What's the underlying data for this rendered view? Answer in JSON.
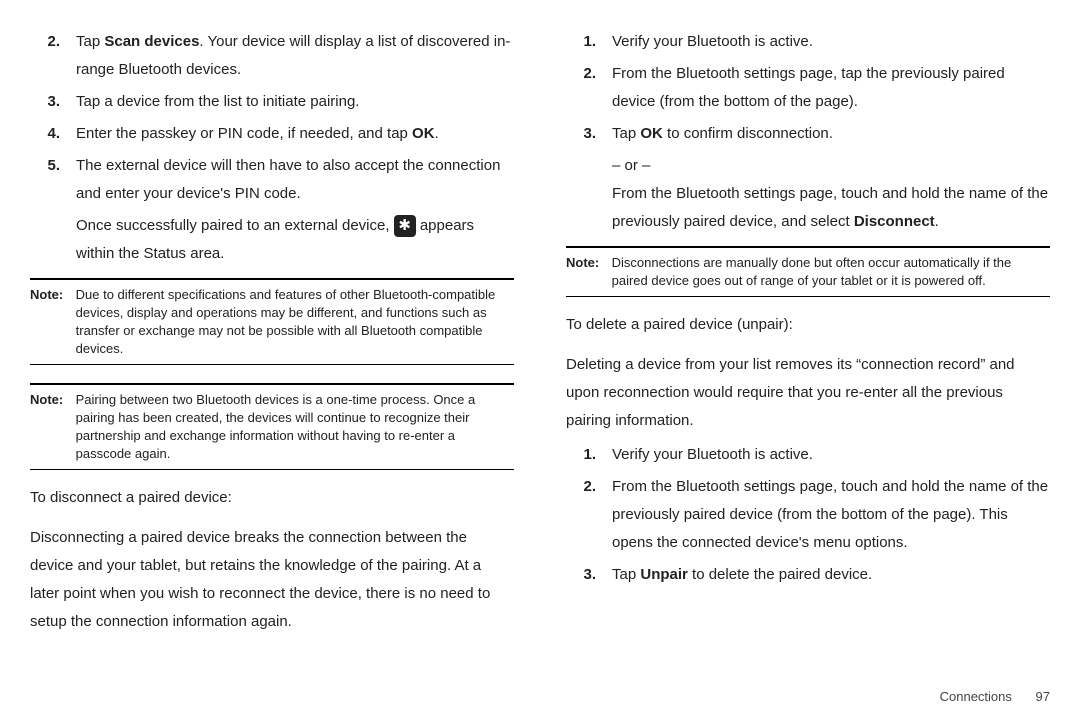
{
  "left": {
    "steps": [
      {
        "n": "2.",
        "t": "Tap <b>Scan devices</b>. Your device will display a list of discovered in-range Bluetooth devices."
      },
      {
        "n": "3.",
        "t": "Tap a device from the list to initiate pairing."
      },
      {
        "n": "4.",
        "t": "Enter the passkey or PIN code, if needed, and tap <b>OK</b>."
      },
      {
        "n": "5.",
        "t": "The external device will then have to also accept the connection and enter your device's PIN code."
      }
    ],
    "paired_before": "Once successfully paired to an external device, ",
    "paired_after": " appears within the Status area.",
    "bt_glyph": "✱",
    "note1_label": "Note:",
    "note1": "Due to different specifications and features of other Bluetooth-compatible devices, display and operations may be different, and functions such as transfer or exchange may not be possible with all Bluetooth compatible devices.",
    "note2_label": "Note:",
    "note2": "Pairing between two Bluetooth devices is a one-time process. Once a pairing has been created, the devices will continue to recognize their partnership and exchange information without having to re-enter a passcode again.",
    "disc_head": "To disconnect a paired device:",
    "disc_body": "Disconnecting a paired device breaks the connection between the device and your tablet, but retains the knowledge of the pairing. At a later point when you wish to reconnect the device, there is no need to setup the connection information again."
  },
  "right": {
    "steps1": [
      {
        "n": "1.",
        "t": "Verify your Bluetooth is active."
      },
      {
        "n": "2.",
        "t": "From the Bluetooth settings page, tap the previously paired device (from the bottom of the page)."
      },
      {
        "n": "3.",
        "t": "Tap <b>OK</b> to confirm disconnection."
      }
    ],
    "or": "– or –",
    "or_body": "From the Bluetooth settings page, touch and hold the name of the previously paired device, and select <b>Disconnect</b>.",
    "note_label": "Note:",
    "note": "Disconnections are manually done but often occur automatically if the paired device goes out of range of your tablet or it is powered off.",
    "del_head": "To delete a paired device (unpair):",
    "del_body": "Deleting a device from your list removes its “connection record” and upon reconnection would require that you re-enter all the previous pairing information.",
    "steps2": [
      {
        "n": "1.",
        "t": "Verify your Bluetooth is active."
      },
      {
        "n": "2.",
        "t": "From the Bluetooth settings page, touch and hold the name of the previously paired device (from the bottom of the page). This opens the connected device's menu options."
      },
      {
        "n": "3.",
        "t": "Tap <b>Unpair</b> to delete the paired device."
      }
    ]
  },
  "footer": {
    "section": "Connections",
    "page": "97"
  }
}
